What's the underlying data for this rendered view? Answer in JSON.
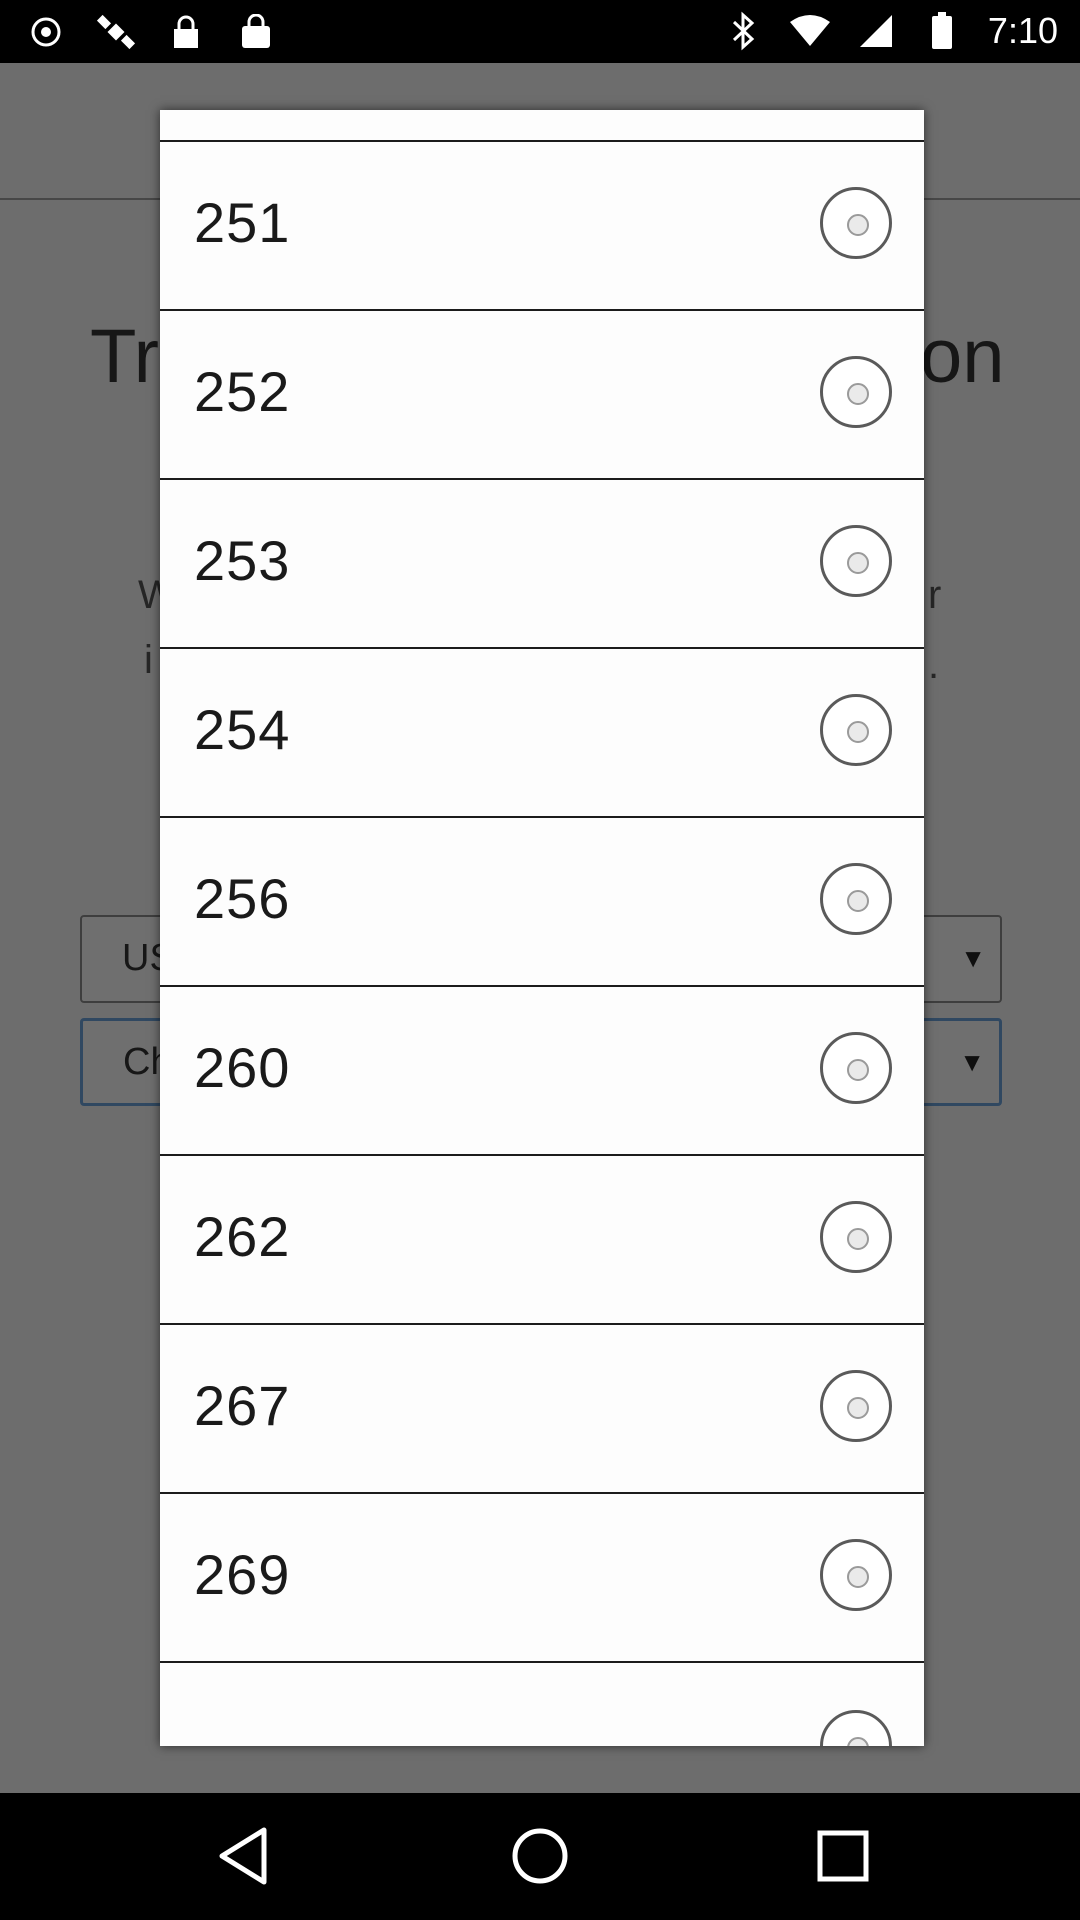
{
  "status_bar": {
    "time": "7:10",
    "left_icons": [
      "fake-gps-icon",
      "satellite-icon",
      "lock-icon",
      "bag-icon"
    ],
    "right_icons": [
      "bluetooth-icon",
      "wifi-icon",
      "signal-icon",
      "battery-icon"
    ]
  },
  "background": {
    "title_start": "Tr",
    "title_end": "on",
    "text_line1_start": "W",
    "text_line1_end": "r",
    "text_line2_start": "i",
    "text_line2_end": ".",
    "select1_text": "US",
    "select2_text": "Ch",
    "select_arrow": "▼"
  },
  "dialog": {
    "options": [
      {
        "label": "251",
        "selected": false
      },
      {
        "label": "252",
        "selected": false
      },
      {
        "label": "253",
        "selected": false
      },
      {
        "label": "254",
        "selected": false
      },
      {
        "label": "256",
        "selected": false
      },
      {
        "label": "260",
        "selected": false
      },
      {
        "label": "262",
        "selected": false
      },
      {
        "label": "267",
        "selected": false
      },
      {
        "label": "269",
        "selected": false
      }
    ]
  },
  "nav": {
    "back": "back-icon",
    "home": "home-icon",
    "recents": "recents-icon"
  }
}
